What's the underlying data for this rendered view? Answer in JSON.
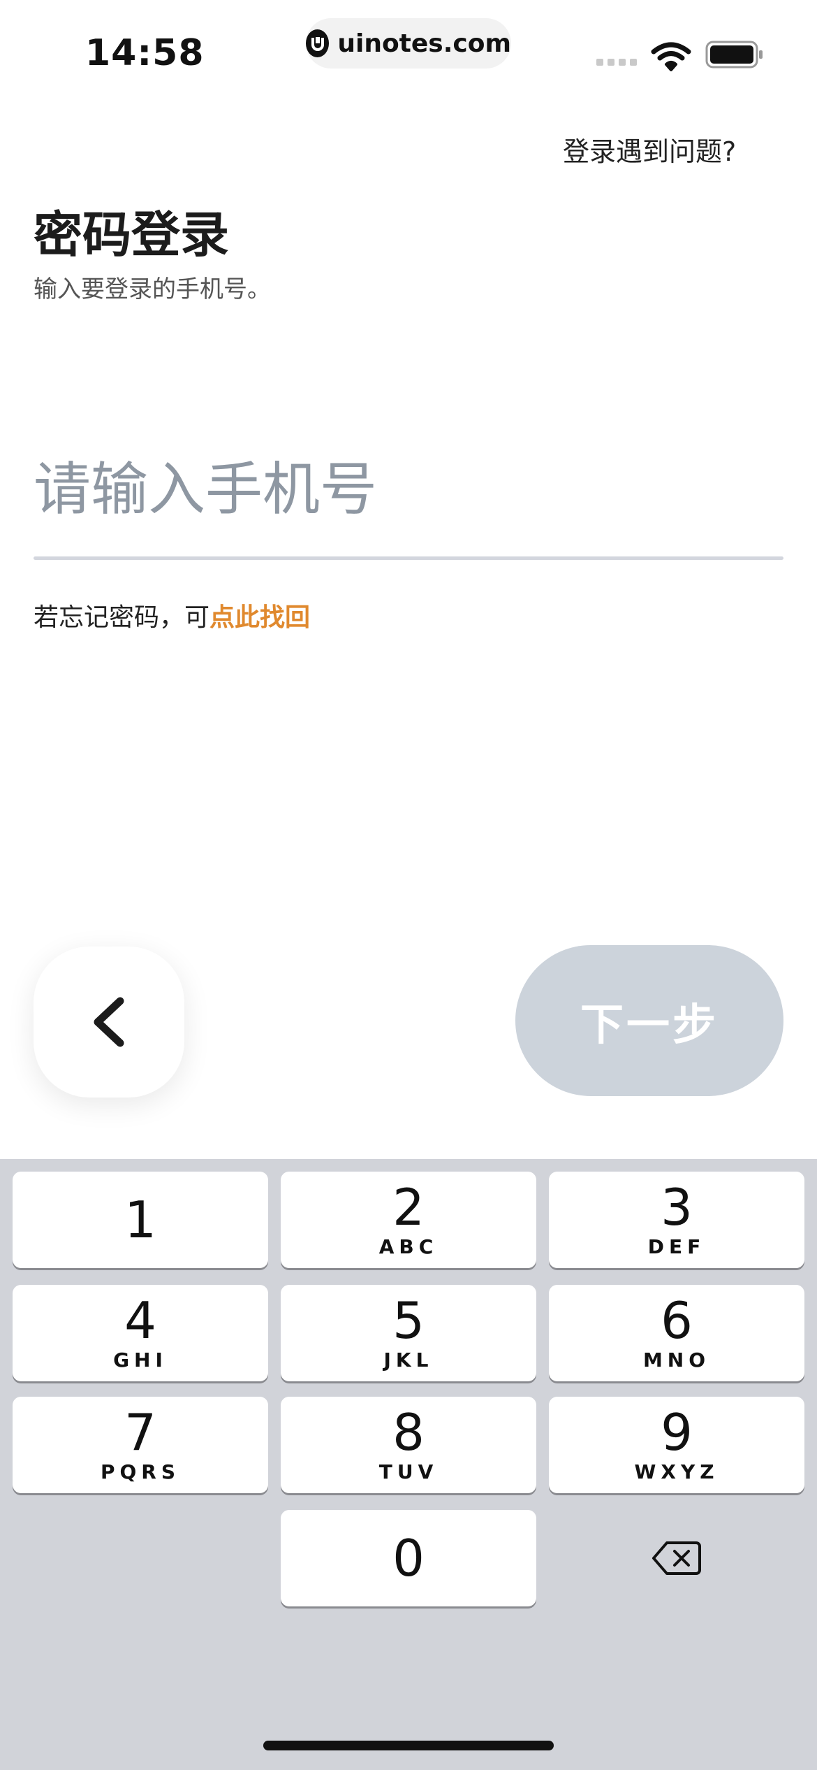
{
  "status_bar": {
    "time": "14:58",
    "url": "uinotes.com",
    "icons": [
      "signal-icon",
      "wifi-icon",
      "battery-icon"
    ]
  },
  "header": {
    "help_link": "登录遇到问题?",
    "title": "密码登录",
    "subtitle": "输入要登录的手机号。"
  },
  "form": {
    "phone_value": "",
    "phone_placeholder": "请输入手机号",
    "forgot_prefix": "若忘记密码，可",
    "forgot_link": "点此找回"
  },
  "actions": {
    "back_icon": "chevron-left-icon",
    "next_label": "下一步"
  },
  "keypad": {
    "keys": [
      {
        "num": "1",
        "letters": ""
      },
      {
        "num": "2",
        "letters": "ABC"
      },
      {
        "num": "3",
        "letters": "DEF"
      },
      {
        "num": "4",
        "letters": "GHI"
      },
      {
        "num": "5",
        "letters": "JKL"
      },
      {
        "num": "6",
        "letters": "MNO"
      },
      {
        "num": "7",
        "letters": "PQRS"
      },
      {
        "num": "8",
        "letters": "TUV"
      },
      {
        "num": "9",
        "letters": "WXYZ"
      },
      {
        "num": "0",
        "letters": ""
      }
    ],
    "delete_icon": "backspace-icon"
  },
  "colors": {
    "accent": "#e0892e",
    "next_button_disabled": "#ccd3db",
    "keypad_background": "#d1d3d9"
  }
}
